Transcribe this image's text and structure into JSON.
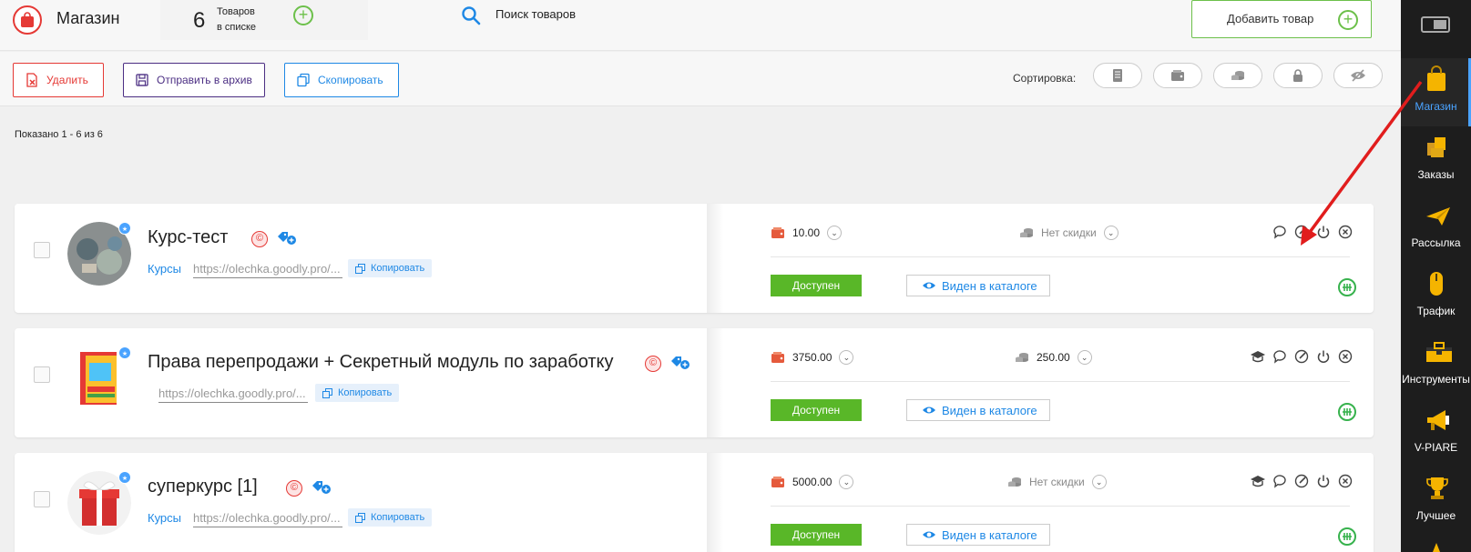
{
  "header": {
    "shop_title": "Магазин",
    "items_count": "6",
    "items_label_1": "Товаров",
    "items_label_2": "в списке",
    "search_label": "Поиск товаров",
    "add_product_label": "Добавить товар"
  },
  "toolbar": {
    "delete_label": "Удалить",
    "archive_label": "Отправить в архив",
    "copy_label": "Скопировать",
    "sort_label": "Сортировка:",
    "sort_icons": [
      "document-icon",
      "wallet-icon",
      "coins-icon",
      "lock-icon",
      "eye-slash-icon"
    ]
  },
  "list": {
    "shown_text": "Показано 1 - 6 из 6"
  },
  "products": [
    {
      "name": "Курс-тест",
      "category": "Курсы",
      "url": "https://olechka.goodly.pro/...",
      "copy_label": "Копировать",
      "price": "10.00",
      "discount": "Нет скидки",
      "status": "Доступен",
      "visibility": "Виден в каталоге",
      "actions": [
        "comment-icon",
        "edit-icon",
        "power-icon",
        "close-icon"
      ]
    },
    {
      "name": "Права перепродажи + Секретный модуль по заработку",
      "category": "",
      "url": "https://olechka.goodly.pro/...",
      "copy_label": "Копировать",
      "price": "3750.00",
      "discount": "250.00",
      "status": "Доступен",
      "visibility": "Виден в каталоге",
      "actions": [
        "graduation-cap-icon",
        "comment-icon",
        "edit-icon",
        "power-icon",
        "close-icon"
      ]
    },
    {
      "name": "суперкурс [1]",
      "category": "Курсы",
      "url": "https://olechka.goodly.pro/...",
      "copy_label": "Копировать",
      "price": "5000.00",
      "discount": "Нет скидки",
      "status": "Доступен",
      "visibility": "Виден в каталоге",
      "actions": [
        "graduation-cap-icon",
        "comment-icon",
        "edit-icon",
        "power-icon",
        "close-icon"
      ]
    }
  ],
  "sidebar": {
    "items": [
      {
        "label": "Магазин",
        "icon": "shopping-bag-icon",
        "active": true
      },
      {
        "label": "Заказы",
        "icon": "boxes-icon"
      },
      {
        "label": "Рассылка",
        "icon": "paper-plane-icon"
      },
      {
        "label": "Трафик",
        "icon": "mouse-icon"
      },
      {
        "label": "Инструменты",
        "icon": "toolbox-icon"
      },
      {
        "label": "V-PIARE",
        "icon": "megaphone-icon"
      },
      {
        "label": "Лучшее",
        "icon": "trophy-icon"
      }
    ]
  },
  "colors": {
    "accent_red": "#e53935",
    "accent_green": "#59b728",
    "accent_blue": "#1e88e5",
    "archive_purple": "#4b2e83",
    "sidebar_bg": "#1d1d1d"
  }
}
